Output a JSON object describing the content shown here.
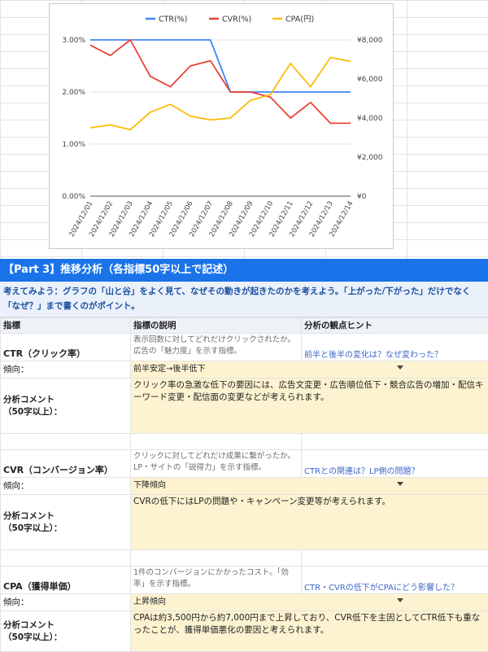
{
  "chart_data": {
    "type": "line",
    "categories": [
      "2024/12/01",
      "2024/12/02",
      "2024/12/03",
      "2024/12/04",
      "2024/12/05",
      "2024/12/06",
      "2024/12/07",
      "2024/12/08",
      "2024/12/09",
      "2024/12/10",
      "2024/12/11",
      "2024/12/12",
      "2024/12/13",
      "2024/12/14"
    ],
    "series": [
      {
        "name": "CTR(%)",
        "axis": "left",
        "color": "#4285f4",
        "values": [
          3.0,
          3.0,
          3.0,
          3.0,
          3.0,
          3.0,
          3.0,
          2.0,
          2.0,
          2.0,
          2.0,
          2.0,
          2.0,
          2.0
        ]
      },
      {
        "name": "CVR(%)",
        "axis": "left",
        "color": "#ea4335",
        "values": [
          2.9,
          2.7,
          3.0,
          2.3,
          2.1,
          2.5,
          2.6,
          2.0,
          2.0,
          1.9,
          1.5,
          1.8,
          1.4,
          1.4
        ]
      },
      {
        "name": "CPA(円)",
        "axis": "right",
        "color": "#fbbc04",
        "values": [
          3500,
          3650,
          3400,
          4300,
          4700,
          4100,
          3900,
          4000,
          4900,
          5200,
          6800,
          5600,
          7100,
          6900
        ]
      }
    ],
    "left_ticks": [
      "0.00%",
      "1.00%",
      "2.00%",
      "3.00%"
    ],
    "right_ticks": [
      "¥0",
      "¥2,000",
      "¥4,000",
      "¥6,000",
      "¥8,000"
    ],
    "ylim_left": [
      0,
      3
    ],
    "ylim_right": [
      0,
      8000
    ],
    "legend_position": "top",
    "grid": true
  },
  "section": {
    "title": "【Part 3】推移分析（各指標50字以上で記述）",
    "intro": "考えてみよう：グラフの「山と谷」をよく見て、なぜその動きが起きたのかを考えよう。「上がった/下がった」だけでなく「なぜ？」まで書くのがポイント。"
  },
  "columns": {
    "indicator": "指標",
    "description": "指標の説明",
    "hint": "分析の観点ヒント"
  },
  "labels": {
    "trend": "傾向：",
    "comment": "分析コメント",
    "comment_note": "（50字以上）："
  },
  "metrics": [
    {
      "name": "CTR（クリック率）",
      "description": "表示回数に対してどれだけクリックされたか。広告の「魅力度」を示す指標。",
      "hint": "前半と後半の変化は？なぜ変わった？",
      "trend": "前半安定→後半低下",
      "comment": "クリック率の急激な低下の要因には、広告文変更・広告順位低下・競合広告の増加・配信キーワード変更・配信面の変更などが考えられます。"
    },
    {
      "name": "CVR（コンバージョン率）",
      "description": "クリックに対してどれだけ成果に繋がったか。LP・サイトの「説得力」を示す指標。",
      "hint": "CTRとの関連は？LP側の問題？",
      "trend": "下降傾向",
      "comment": "CVRの低下にはLPの問題や・キャンペーン変更等が考えられます。"
    },
    {
      "name": "CPA（獲得単価）",
      "description": "1件のコンバージョンにかかったコスト。「効率」を示す指標。",
      "hint": "CTR・CVRの低下がCPAにどう影響した？",
      "trend": "上昇傾向",
      "comment": "CPAは約3,500円から約7,000円まで上昇しており、CVR低下を主因としてCTR低下も重なったことが、獲得単価悪化の要因と考えられます。"
    }
  ]
}
